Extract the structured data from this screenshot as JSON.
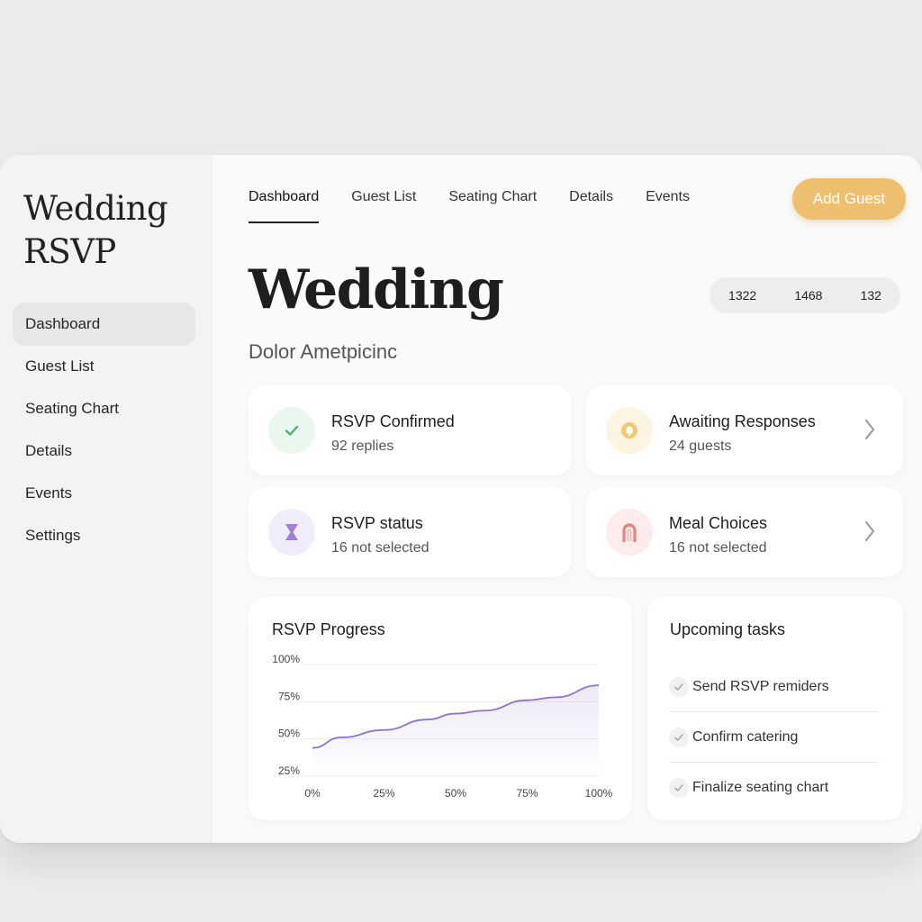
{
  "sidebar": {
    "brand_line1": "Wedding",
    "brand_line2": "RSVP",
    "items": [
      {
        "label": "Dashboard",
        "active": true
      },
      {
        "label": "Guest List"
      },
      {
        "label": "Seating Chart"
      },
      {
        "label": "Details"
      },
      {
        "label": "Events"
      },
      {
        "label": "Settings"
      }
    ]
  },
  "tabs": [
    {
      "label": "Dashboard",
      "active": true
    },
    {
      "label": "Guest List"
    },
    {
      "label": "Seating Chart"
    },
    {
      "label": "Details"
    },
    {
      "label": "Events"
    }
  ],
  "header": {
    "add_button": "Add Guest",
    "title": "Wedding",
    "subtitle": "Dolor Ametpicinc",
    "stats": [
      "1322",
      "1468",
      "132"
    ]
  },
  "cards": [
    {
      "title": "RSVP Confirmed",
      "sub": "92 replies",
      "icon": "check-icon",
      "color": "#4caf73"
    },
    {
      "title": "Awaiting Responses",
      "sub": "24 guests",
      "icon": "bell-icon",
      "color": "#e3b154"
    },
    {
      "title": "RSVP status",
      "sub": "16 not selected",
      "icon": "hourglass-icon",
      "color": "#a27ed8"
    },
    {
      "title": "Meal Choices",
      "sub": "16 not selected",
      "icon": "meal-icon",
      "color": "#e8827f"
    }
  ],
  "progress": {
    "title": "RSVP Progress",
    "chart_data": {
      "type": "area",
      "x_ticks": [
        "0%",
        "25%",
        "50%",
        "75%",
        "100%"
      ],
      "y_ticks": [
        "100%",
        "75%",
        "50%",
        "25%"
      ],
      "x": [
        0,
        10,
        25,
        40,
        50,
        60,
        75,
        85,
        100
      ],
      "y": [
        44,
        51,
        56,
        63,
        67,
        69,
        76,
        78,
        86
      ],
      "xlim": [
        0,
        100
      ],
      "ylim": [
        25,
        100
      ],
      "color": "#8b74c9",
      "grid": true
    }
  },
  "tasks": {
    "title": "Upcoming tasks",
    "items": [
      "Send RSVP remiders",
      "Confirm catering",
      "Finalize seating chart"
    ]
  }
}
